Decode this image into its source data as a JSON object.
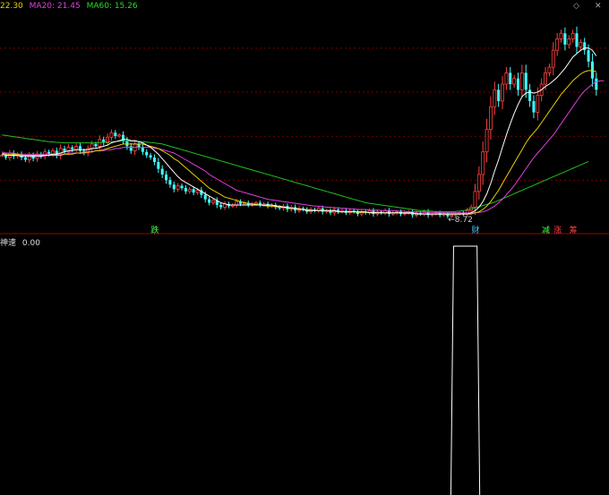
{
  "legend": {
    "ma10_value": "22.30",
    "ma20": "MA20: 21.45",
    "ma60": "MA60: 15.26"
  },
  "sub_legend": {
    "name": "神速",
    "value": "0.00"
  },
  "corner_icons": [
    "diamond-icon",
    "close-icon"
  ],
  "colors": {
    "up": "#ff4040",
    "down": "#40ffff",
    "ma10": "#ffffff",
    "ma20": "#e8d000",
    "ma60_mid": "#e040e0",
    "ma60": "#20c020",
    "grid": "#7a0000"
  },
  "chart_data": {
    "type": "candlestick",
    "main_panel": {
      "ylim": [
        7.5,
        27.0
      ],
      "low_annotation": {
        "text": "8.72",
        "index": 115,
        "value": 8.72
      },
      "signal_labels": [
        {
          "text": "跌",
          "index": 39,
          "color": "#40ff40"
        },
        {
          "text": "财",
          "index": 121,
          "color": "#40c0ff"
        },
        {
          "text": "减",
          "index": 139,
          "color": "#40ff40"
        },
        {
          "text": "涨",
          "index": 142,
          "color": "#ff4040"
        },
        {
          "text": "筹",
          "index": 146,
          "color": "#ff4040"
        }
      ],
      "close": [
        14.2,
        14.0,
        14.4,
        14.1,
        14.3,
        14.0,
        13.8,
        14.2,
        13.9,
        14.3,
        14.1,
        14.5,
        14.3,
        14.6,
        14.2,
        14.8,
        14.5,
        14.9,
        14.7,
        15.0,
        14.6,
        14.4,
        14.8,
        15.2,
        15.0,
        15.6,
        15.3,
        15.8,
        16.2,
        15.9,
        16.0,
        15.5,
        15.0,
        14.6,
        15.2,
        14.9,
        14.5,
        14.2,
        14.0,
        13.6,
        13.0,
        12.5,
        12.0,
        11.6,
        11.2,
        11.5,
        11.3,
        11.0,
        11.2,
        10.9,
        11.1,
        10.7,
        10.3,
        10.0,
        10.2,
        9.8,
        9.6,
        9.9,
        9.7,
        9.8,
        10.1,
        9.9,
        10.0,
        9.8,
        9.9,
        10.0,
        9.8,
        9.9,
        9.7,
        9.8,
        9.6,
        9.5,
        9.7,
        9.4,
        9.6,
        9.3,
        9.5,
        9.4,
        9.2,
        9.4,
        9.3,
        9.5,
        9.2,
        9.3,
        9.1,
        9.4,
        9.2,
        9.3,
        9.1,
        9.3,
        9.2,
        9.0,
        9.2,
        9.1,
        9.3,
        9.0,
        9.2,
        9.1,
        9.3,
        9.0,
        9.1,
        9.2,
        9.0,
        9.1,
        9.2,
        8.9,
        9.1,
        9.0,
        9.2,
        8.9,
        9.0,
        9.1,
        8.9,
        9.0,
        8.8,
        8.9,
        9.0,
        9.1,
        9.0,
        9.3,
        9.6,
        11.0,
        12.5,
        14.5,
        16.5,
        18.5,
        20.0,
        19.0,
        20.5,
        21.5,
        20.5,
        21.0,
        20.0,
        21.5,
        20.0,
        19.0,
        18.0,
        19.5,
        20.5,
        21.5,
        22.0,
        23.5,
        24.5,
        25.0,
        24.0,
        24.5,
        25.0,
        23.8,
        24.2,
        23.5,
        22.5,
        21.0,
        20.0
      ],
      "ma10": [
        14.3,
        14.2,
        14.2,
        14.2,
        14.2,
        14.1,
        14.1,
        14.1,
        14.1,
        14.1,
        14.1,
        14.2,
        14.2,
        14.3,
        14.3,
        14.4,
        14.5,
        14.6,
        14.6,
        14.7,
        14.7,
        14.7,
        14.7,
        14.8,
        14.8,
        14.9,
        15.0,
        15.1,
        15.3,
        15.4,
        15.5,
        15.6,
        15.6,
        15.5,
        15.5,
        15.4,
        15.3,
        15.1,
        14.9,
        14.6,
        14.3,
        13.9,
        13.5,
        13.1,
        12.7,
        12.3,
        12.0,
        11.8,
        11.6,
        11.4,
        11.2,
        11.0,
        10.8,
        10.6,
        10.4,
        10.2,
        10.0,
        9.9,
        9.8,
        9.8,
        9.8,
        9.8,
        9.8,
        9.8,
        9.8,
        9.8,
        9.8,
        9.8,
        9.8,
        9.8,
        9.7,
        9.7,
        9.6,
        9.6,
        9.5,
        9.5,
        9.4,
        9.4,
        9.3,
        9.3,
        9.3,
        9.3,
        9.3,
        9.3,
        9.3,
        9.3,
        9.2,
        9.2,
        9.2,
        9.2,
        9.2,
        9.2,
        9.2,
        9.2,
        9.1,
        9.1,
        9.1,
        9.1,
        9.1,
        9.1,
        9.1,
        9.1,
        9.1,
        9.1,
        9.1,
        9.1,
        9.0,
        9.0,
        9.0,
        9.0,
        9.0,
        9.0,
        9.0,
        9.0,
        9.0,
        9.0,
        9.0,
        9.0,
        9.0,
        9.0,
        9.1,
        9.3,
        9.6,
        10.1,
        10.8,
        11.7,
        12.8,
        13.8,
        14.9,
        16.0,
        17.0,
        17.9,
        18.7,
        19.4,
        19.7,
        19.8,
        19.7,
        19.8,
        20.0,
        20.3,
        20.5,
        20.8,
        21.1,
        21.5,
        21.9,
        22.4,
        22.9,
        23.2,
        23.5,
        23.7,
        23.7,
        23.5,
        23.0
      ],
      "ma20": [
        14.4,
        14.3,
        14.3,
        14.3,
        14.3,
        14.2,
        14.2,
        14.2,
        14.2,
        14.2,
        14.2,
        14.2,
        14.2,
        14.2,
        14.2,
        14.2,
        14.3,
        14.3,
        14.3,
        14.4,
        14.4,
        14.4,
        14.5,
        14.5,
        14.6,
        14.6,
        14.7,
        14.8,
        14.9,
        15.0,
        15.1,
        15.2,
        15.2,
        15.2,
        15.2,
        15.2,
        15.2,
        15.1,
        15.0,
        14.9,
        14.8,
        14.6,
        14.4,
        14.2,
        13.9,
        13.7,
        13.4,
        13.1,
        12.8,
        12.5,
        12.2,
        11.9,
        11.6,
        11.3,
        11.1,
        10.9,
        10.7,
        10.5,
        10.4,
        10.3,
        10.2,
        10.1,
        10.0,
        9.95,
        9.9,
        9.85,
        9.8,
        9.75,
        9.7,
        9.7,
        9.65,
        9.6,
        9.6,
        9.55,
        9.5,
        9.5,
        9.45,
        9.4,
        9.4,
        9.35,
        9.35,
        9.3,
        9.3,
        9.3,
        9.25,
        9.25,
        9.2,
        9.2,
        9.2,
        9.2,
        9.2,
        9.15,
        9.15,
        9.15,
        9.15,
        9.15,
        9.1,
        9.1,
        9.1,
        9.1,
        9.1,
        9.1,
        9.1,
        9.05,
        9.05,
        9.05,
        9.05,
        9.0,
        9.0,
        9.0,
        9.0,
        9.0,
        9.0,
        9.0,
        9.0,
        9.0,
        9.0,
        9.0,
        9.0,
        9.0,
        9.0,
        9.1,
        9.2,
        9.4,
        9.7,
        10.1,
        10.6,
        11.1,
        11.7,
        12.3,
        12.9,
        13.5,
        14.1,
        14.7,
        15.3,
        15.8,
        16.2,
        16.6,
        17.1,
        17.6,
        18.1,
        18.6,
        19.1,
        19.6,
        20.0,
        20.4,
        20.8,
        21.1,
        21.4,
        21.6,
        21.7,
        21.7,
        21.6
      ],
      "ma60_mid": [
        14.5,
        14.4,
        14.4,
        14.4,
        14.3,
        14.3,
        14.3,
        14.3,
        14.3,
        14.3,
        14.3,
        14.3,
        14.3,
        14.3,
        14.3,
        14.3,
        14.3,
        14.4,
        14.4,
        14.4,
        14.4,
        14.5,
        14.5,
        14.5,
        14.6,
        14.6,
        14.6,
        14.7,
        14.7,
        14.8,
        14.8,
        14.9,
        14.9,
        14.9,
        14.9,
        14.9,
        14.9,
        14.9,
        14.9,
        14.8,
        14.8,
        14.7,
        14.6,
        14.5,
        14.4,
        14.2,
        14.0,
        13.8,
        13.6,
        13.4,
        13.2,
        13.0,
        12.8,
        12.5,
        12.3,
        12.1,
        11.9,
        11.7,
        11.5,
        11.3,
        11.1,
        11.0,
        10.9,
        10.8,
        10.7,
        10.6,
        10.5,
        10.4,
        10.3,
        10.25,
        10.2,
        10.15,
        10.1,
        10.05,
        10.0,
        9.95,
        9.9,
        9.85,
        9.8,
        9.75,
        9.7,
        9.7,
        9.65,
        9.6,
        9.6,
        9.55,
        9.55,
        9.5,
        9.5,
        9.45,
        9.45,
        9.4,
        9.4,
        9.4,
        9.35,
        9.35,
        9.35,
        9.3,
        9.3,
        9.3,
        9.3,
        9.25,
        9.25,
        9.25,
        9.2,
        9.2,
        9.2,
        9.2,
        9.15,
        9.15,
        9.15,
        9.15,
        9.1,
        9.1,
        9.1,
        9.1,
        9.1,
        9.1,
        9.1,
        9.1,
        9.1,
        9.1,
        9.15,
        9.2,
        9.3,
        9.5,
        9.7,
        10.0,
        10.3,
        10.7,
        11.1,
        11.5,
        12.0,
        12.5,
        13.0,
        13.5,
        14.0,
        14.4,
        14.8,
        15.2,
        15.6,
        16.0,
        16.5,
        17.0,
        17.5,
        18.0,
        18.5,
        19.0,
        19.5,
        19.9,
        20.2,
        20.5,
        20.7,
        20.8,
        20.8
      ],
      "ma60": [
        16.0,
        15.95,
        15.9,
        15.85,
        15.8,
        15.75,
        15.7,
        15.65,
        15.6,
        15.55,
        15.5,
        15.45,
        15.4,
        15.38,
        15.35,
        15.33,
        15.3,
        15.3,
        15.3,
        15.3,
        15.3,
        15.3,
        15.3,
        15.3,
        15.3,
        15.32,
        15.35,
        15.38,
        15.4,
        15.42,
        15.45,
        15.45,
        15.45,
        15.45,
        15.45,
        15.43,
        15.4,
        15.37,
        15.33,
        15.3,
        15.25,
        15.2,
        15.1,
        15.0,
        14.9,
        14.8,
        14.7,
        14.6,
        14.5,
        14.4,
        14.3,
        14.2,
        14.1,
        14.0,
        13.9,
        13.8,
        13.7,
        13.6,
        13.5,
        13.4,
        13.3,
        13.2,
        13.1,
        13.0,
        12.9,
        12.8,
        12.7,
        12.6,
        12.5,
        12.4,
        12.3,
        12.2,
        12.1,
        12.0,
        11.9,
        11.8,
        11.7,
        11.6,
        11.5,
        11.4,
        11.3,
        11.2,
        11.1,
        11.0,
        10.9,
        10.8,
        10.7,
        10.6,
        10.5,
        10.4,
        10.3,
        10.2,
        10.1,
        10.0,
        9.95,
        9.9,
        9.85,
        9.8,
        9.75,
        9.7,
        9.65,
        9.6,
        9.55,
        9.5,
        9.45,
        9.4,
        9.35,
        9.3,
        9.28,
        9.26,
        9.24,
        9.22,
        9.2,
        9.2,
        9.2,
        9.2,
        9.22,
        9.25,
        9.3,
        9.38,
        9.45,
        9.55,
        9.65,
        9.75,
        9.85,
        9.95,
        10.05,
        10.2,
        10.35,
        10.5,
        10.65,
        10.8,
        10.95,
        11.1,
        11.25,
        11.4,
        11.55,
        11.7,
        11.85,
        12.0,
        12.15,
        12.3,
        12.45,
        12.6,
        12.75,
        12.9,
        13.05,
        13.2,
        13.35,
        13.5,
        13.65
      ]
    },
    "sub_panel": {
      "name": "神速",
      "value": 0.0,
      "ylim": [
        0,
        1
      ],
      "spike": {
        "start_index": 116,
        "end_index": 121,
        "value": 1.0
      }
    }
  }
}
